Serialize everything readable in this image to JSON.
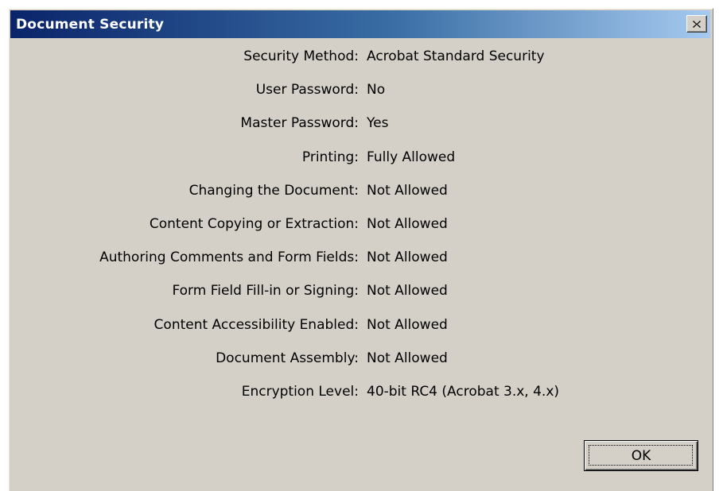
{
  "window": {
    "title": "Document Security"
  },
  "rows": [
    {
      "label": "Security Method:",
      "value": "Acrobat Standard Security"
    },
    {
      "label": "User Password:",
      "value": "No"
    },
    {
      "label": "Master Password:",
      "value": "Yes"
    },
    {
      "label": "Printing:",
      "value": "Fully Allowed"
    },
    {
      "label": "Changing the Document:",
      "value": "Not Allowed"
    },
    {
      "label": "Content Copying or Extraction:",
      "value": "Not Allowed"
    },
    {
      "label": "Authoring Comments and Form Fields:",
      "value": "Not Allowed"
    },
    {
      "label": "Form Field Fill-in or Signing:",
      "value": "Not Allowed"
    },
    {
      "label": "Content Accessibility Enabled:",
      "value": "Not Allowed"
    },
    {
      "label": "Document Assembly:",
      "value": "Not Allowed"
    },
    {
      "label": "Encryption Level:",
      "value": "40-bit RC4 (Acrobat 3.x, 4.x)"
    }
  ],
  "buttons": {
    "ok_label": "OK"
  },
  "icons": {
    "close": "close-icon"
  },
  "colors": {
    "titlebar_start": "#0a246a",
    "titlebar_end": "#a6caf0",
    "dialog_face": "#d4d0c8"
  }
}
